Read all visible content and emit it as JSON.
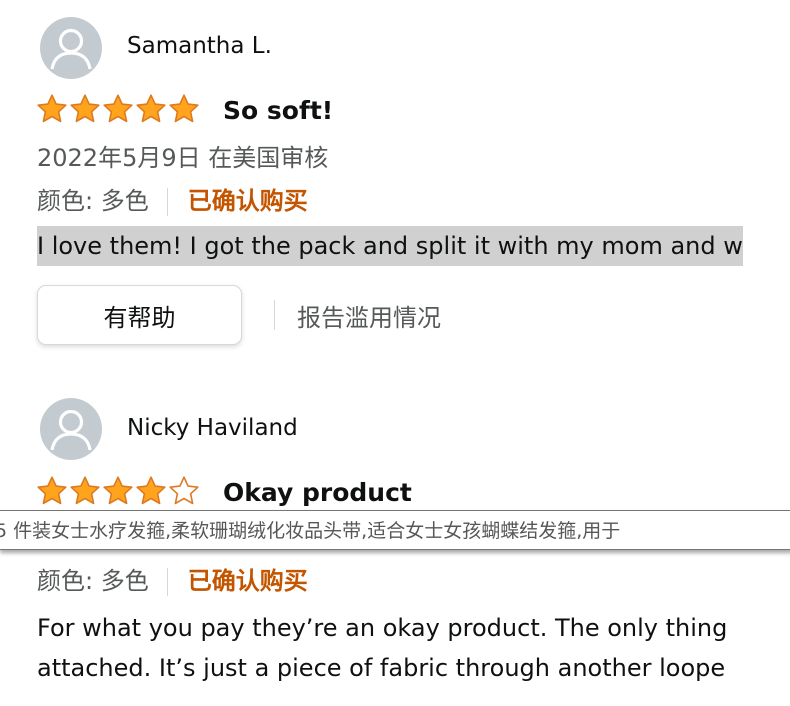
{
  "reviews": [
    {
      "author": "Samantha L.",
      "rating": 5,
      "max_rating": 5,
      "title": "So soft!",
      "date": "2022年5月9日 在美国审核",
      "color_label": "颜色: 多色",
      "verified_label": "已确认购买",
      "body": "I love them! I got the pack and split it with my mom and w",
      "helpful_label": "有帮助",
      "report_label": "报告滥用情况"
    },
    {
      "author": "Nicky Haviland",
      "rating": 4,
      "max_rating": 5,
      "title": "Okay product",
      "color_label": "颜色: 多色",
      "verified_label": "已确认购买",
      "body_lines": [
        "For what you pay they’re an okay product. The only thing",
        "attached. It’s just a piece of fabric through another loope"
      ]
    }
  ],
  "tooltip": {
    "text": "5 件装女士水疗发箍,柔软珊瑚绒化妆品头带,适合女士女孩蝴蝶结发箍,用于"
  },
  "colors": {
    "star_fill": "#ffa41c",
    "star_outline": "#de7921",
    "verified": "#c45500",
    "avatar_bg": "#c4cbd0",
    "highlight": "#d0d0d0"
  },
  "icons": {
    "avatar": "user-avatar-icon",
    "star_full": "star-filled-icon",
    "star_empty": "star-empty-icon"
  }
}
